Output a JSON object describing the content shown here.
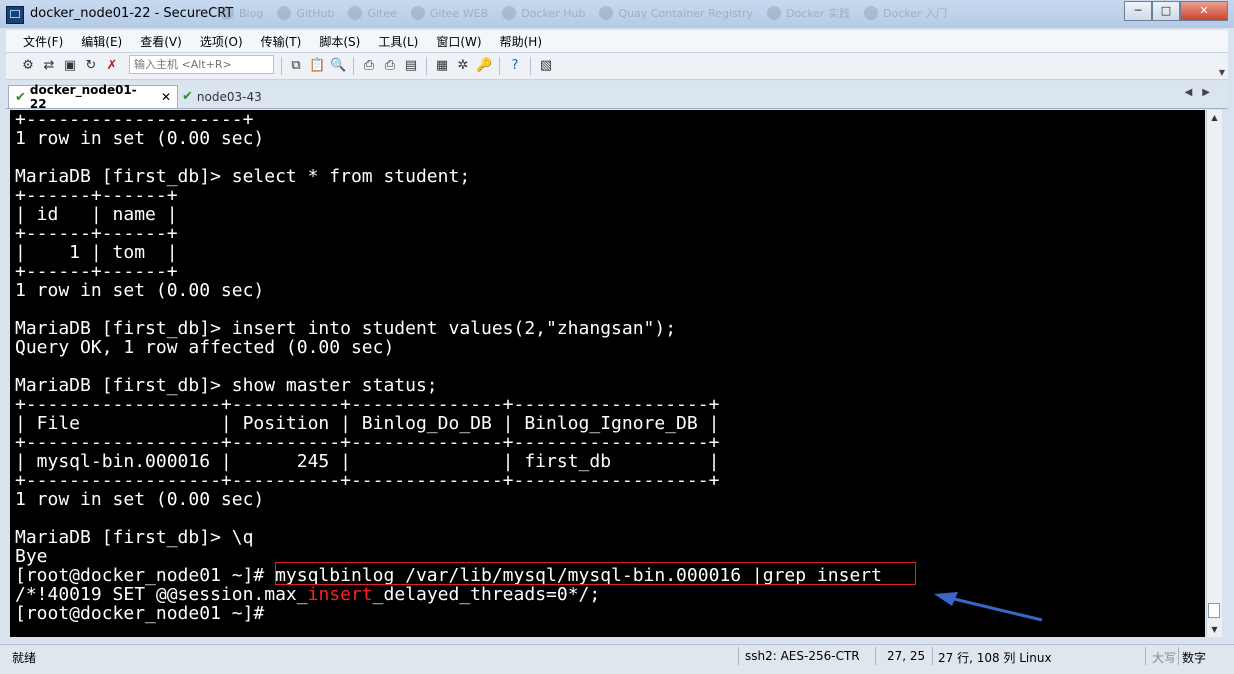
{
  "window": {
    "title": "docker_node01-22 - SecureCRT",
    "buttons": {
      "minimize": "─",
      "maximize": "□",
      "close": "✕"
    },
    "background_tabs": [
      "Blog",
      "GitHub",
      "Gitee",
      "Gitee WEB",
      "Docker Hub",
      "Quay Container Registry",
      "Docker 实践",
      "Docker 入门"
    ]
  },
  "menu": [
    "文件(F)",
    "编辑(E)",
    "查看(V)",
    "选项(O)",
    "传输(T)",
    "脚本(S)",
    "工具(L)",
    "窗口(W)",
    "帮助(H)"
  ],
  "toolbar": {
    "host_placeholder": "输入主机 <Alt+R>"
  },
  "tabs": [
    {
      "label": "docker_node01-22",
      "close": "✕"
    },
    {
      "label": "node03-43"
    }
  ],
  "terminal": {
    "lines": [
      "+--------------------+",
      "1 row in set (0.00 sec)",
      "",
      "MariaDB [first_db]> select * from student;",
      "+------+------+",
      "| id   | name |",
      "+------+------+",
      "|    1 | tom  |",
      "+------+------+",
      "1 row in set (0.00 sec)",
      "",
      "MariaDB [first_db]> insert into student values(2,\"zhangsan\");",
      "Query OK, 1 row affected (0.00 sec)",
      "",
      "MariaDB [first_db]> show master status;",
      "+------------------+----------+--------------+------------------+",
      "| File             | Position | Binlog_Do_DB | Binlog_Ignore_DB |",
      "+------------------+----------+--------------+------------------+",
      "| mysql-bin.000016 |      245 |              | first_db         |",
      "+------------------+----------+--------------+------------------+",
      "1 row in set (0.00 sec)",
      "",
      "MariaDB [first_db]> \\q",
      "Bye"
    ],
    "prompt_cmd": "[root@docker_node01 ~]# mysqlbinlog /var/lib/mysql/mysql-bin.000016 |grep insert",
    "output_pre": "/*!40019 SET @@session.max_",
    "output_match": "insert",
    "output_post": "_delayed_threads=0*/;",
    "final_prompt": "[root@docker_node01 ~]# "
  },
  "status": {
    "ready": "就绪",
    "protocol": "ssh2: AES-256-CTR",
    "cursor": "27,  25",
    "size": "27 行, 108 列 Linux",
    "caps": "大写",
    "num": "数字"
  },
  "colors": {
    "highlight_box": "#e02020",
    "grep_match": "#ff1f1f",
    "annotation_arrow": "#3a66c8"
  }
}
